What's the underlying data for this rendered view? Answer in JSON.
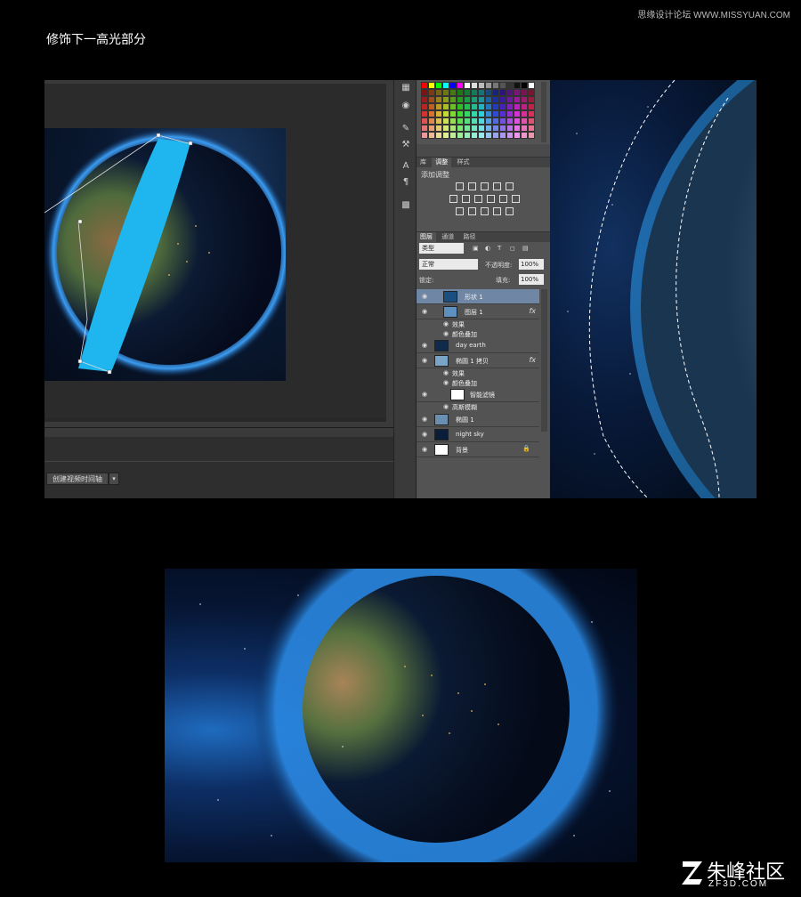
{
  "heading": "修饰下一高光部分",
  "watermark_top": "思缘设计论坛 WWW.MISSYUAN.COM",
  "timeline": {
    "button": "创建视频时间轴"
  },
  "adjustments": {
    "tabs": [
      "库",
      "调整",
      "样式"
    ],
    "title": "添加调整"
  },
  "layers_panel": {
    "tabs": [
      "图层",
      "通道",
      "路径"
    ],
    "filter_kind": "类型",
    "blend_mode": "正常",
    "opacity_label": "不透明度:",
    "opacity_value": "100%",
    "lock_label": "锁定:",
    "fill_label": "填充:",
    "fill_value": "100%",
    "layers": [
      {
        "name": "形状 1",
        "selected": true
      },
      {
        "name": "图层 1",
        "fx": "fx"
      },
      {
        "name": "效果",
        "sub": true
      },
      {
        "name": "颜色叠加",
        "sub": true
      },
      {
        "name": "day earth"
      },
      {
        "name": "椭圆 1 拷贝",
        "fx": "fx"
      },
      {
        "name": "效果",
        "sub": true
      },
      {
        "name": "颜色叠加",
        "sub": true
      },
      {
        "name": "智能滤镜"
      },
      {
        "name": "高斯模糊",
        "sub": true
      },
      {
        "name": "椭圆 1"
      },
      {
        "name": "night sky"
      },
      {
        "name": "背景"
      }
    ]
  },
  "brand": {
    "name": "朱峰社区",
    "sub": "ZF3D.COM"
  },
  "colors": {
    "highlight": "#1fb5ee",
    "panel": "#535353",
    "selected_layer": "#6f86a5"
  }
}
